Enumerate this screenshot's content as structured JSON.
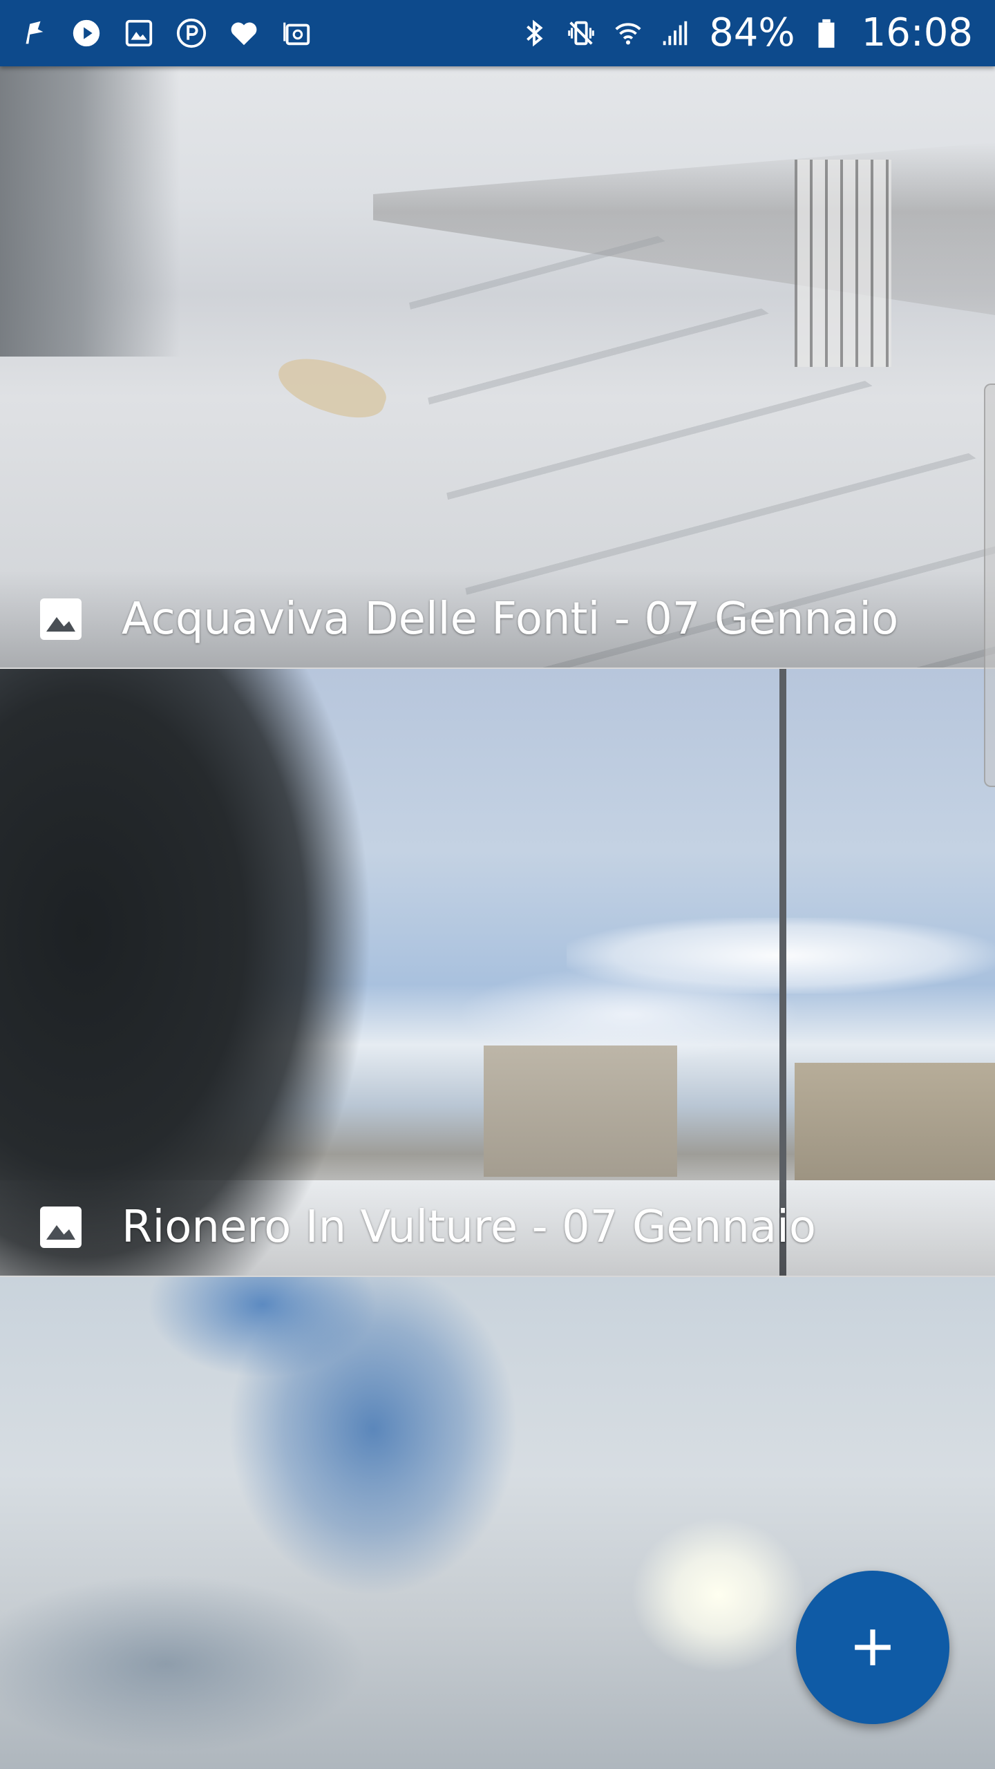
{
  "status_bar": {
    "notification_icons": [
      "flag-icon",
      "play-icon",
      "gallery-icon",
      "parking-icon",
      "heart-icon",
      "email-icon"
    ],
    "system_icons": [
      "bluetooth-icon",
      "vibrate-icon",
      "wifi-icon",
      "signal-icon"
    ],
    "battery_percent": "84%",
    "time": "16:08"
  },
  "feed": {
    "cards": [
      {
        "caption": "Acquaviva Delle Fonti - 07 Gennaio",
        "icon": "image-icon"
      },
      {
        "caption": "Rionero In Vulture - 07 Gennaio",
        "icon": "image-icon"
      },
      {
        "caption": "",
        "icon": ""
      }
    ]
  },
  "fab": {
    "icon": "plus-icon"
  },
  "colors": {
    "status_bar": "#0d4a8c",
    "fab": "#0f5ba6",
    "caption_text": "#ffffff"
  }
}
